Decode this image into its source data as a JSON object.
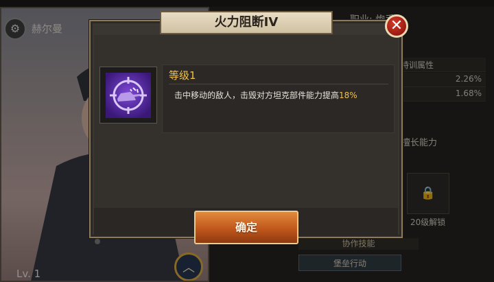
{
  "background": {
    "officer_name": "赫尔曼",
    "level": "Lv. 1",
    "class_label": "职业: 炮手",
    "training_attr_label": "特训属性",
    "stat_values": [
      "2.26%",
      "1.68%"
    ],
    "expertise_label": "擅长能力",
    "locked_slot_label": "20级解锁",
    "coop_skill_label": "协作技能",
    "fortress_action_label": "堡垒行动"
  },
  "dialog": {
    "title": "火力阻断IV",
    "skill_icon": "tank-crosshair-icon",
    "level_label": "等级1",
    "description_prefix": "击中移动的敌人，击毁对方坦克部件能力提高",
    "description_highlight": "18%",
    "confirm_label": "确定"
  },
  "colors": {
    "highlight": "#f0c24a",
    "button_orange": "#c0571c",
    "close_red": "#c42a1c",
    "icon_purple": "#5b2aa8"
  }
}
